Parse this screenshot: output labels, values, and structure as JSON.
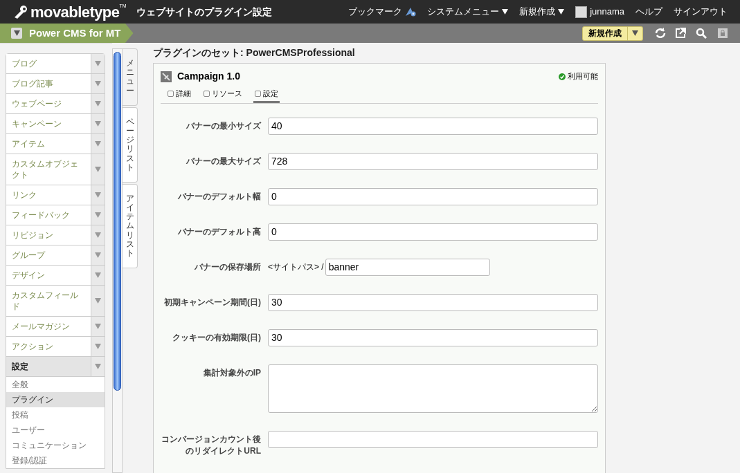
{
  "header": {
    "logo": "movabletype",
    "logo_mark": "TM",
    "title": "ウェブサイトのプラグイン設定",
    "nav": [
      {
        "label": "ブックマーク",
        "kind": "bookmark"
      },
      {
        "label": "システムメニュー",
        "kind": "menu"
      },
      {
        "label": "新規作成",
        "kind": "menu"
      },
      {
        "label": "junnama",
        "kind": "user"
      },
      {
        "label": "ヘルプ",
        "kind": "link"
      },
      {
        "label": "サインアウト",
        "kind": "link"
      }
    ]
  },
  "site_bar": {
    "name": "Power CMS for MT",
    "new_button": "新規作成"
  },
  "sidebar": {
    "items": [
      {
        "label": "ブログ",
        "expanded": false
      },
      {
        "label": "ブログ記事",
        "expanded": false
      },
      {
        "label": "ウェブページ",
        "expanded": false
      },
      {
        "label": "キャンペーン",
        "expanded": false
      },
      {
        "label": "アイテム",
        "expanded": false
      },
      {
        "label": "カスタムオブジェクト",
        "expanded": false
      },
      {
        "label": "リンク",
        "expanded": false
      },
      {
        "label": "フィードバック",
        "expanded": false
      },
      {
        "label": "リビジョン",
        "expanded": false
      },
      {
        "label": "グループ",
        "expanded": false
      },
      {
        "label": "デザイン",
        "expanded": false
      },
      {
        "label": "カスタムフィールド",
        "expanded": false
      },
      {
        "label": "メールマガジン",
        "expanded": false
      },
      {
        "label": "アクション",
        "expanded": false
      },
      {
        "label": "設定",
        "expanded": true,
        "children": [
          {
            "label": "全般",
            "selected": false
          },
          {
            "label": "プラグイン",
            "selected": true
          },
          {
            "label": "投稿",
            "selected": false
          },
          {
            "label": "ユーザー",
            "selected": false
          },
          {
            "label": "コミュニケーション",
            "selected": false
          },
          {
            "label": "登録/認証",
            "selected": false
          }
        ]
      }
    ],
    "side_tabs": [
      {
        "label": "メニュー",
        "selected": true
      },
      {
        "label": "ページリスト",
        "selected": false
      },
      {
        "label": "アイテムリスト",
        "selected": false
      }
    ]
  },
  "main": {
    "heading": "プラグインのセット: PowerCMSProfessional",
    "plugin": {
      "name": "Campaign 1.0",
      "status": "利用可能",
      "tabs": [
        {
          "label": "詳細",
          "selected": false
        },
        {
          "label": "リソース",
          "selected": false
        },
        {
          "label": "設定",
          "selected": true
        }
      ],
      "fields": [
        {
          "label": "バナーの最小サイズ",
          "kind": "text",
          "value": "40"
        },
        {
          "label": "バナーの最大サイズ",
          "kind": "text",
          "value": "728"
        },
        {
          "label": "バナーのデフォルト幅",
          "kind": "text",
          "value": "0"
        },
        {
          "label": "バナーのデフォルト高",
          "kind": "text",
          "value": "0"
        },
        {
          "label": "バナーの保存場所",
          "kind": "prefixed",
          "prefix": "<サイトパス> /",
          "value": "banner"
        },
        {
          "label": "初期キャンペーン期間(日)",
          "kind": "text",
          "value": "30"
        },
        {
          "label": "クッキーの有効期限(日)",
          "kind": "text",
          "value": "30"
        },
        {
          "label": "集計対象外のIP",
          "kind": "textarea"
        },
        {
          "label": "コンバージョンカウント後のリダイレクトURL",
          "kind": "text"
        }
      ]
    }
  }
}
